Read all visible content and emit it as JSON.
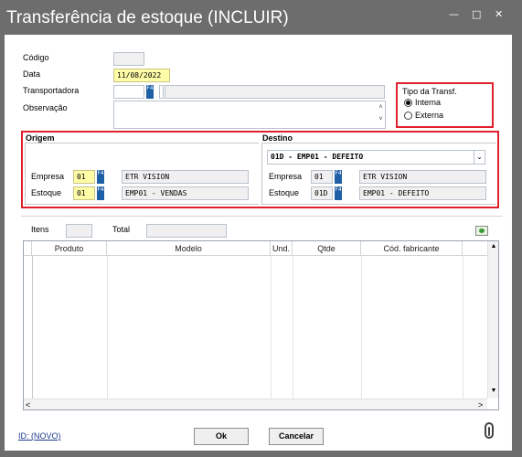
{
  "window": {
    "title": "Transferência de estoque (INCLUIR)",
    "minimize": "—",
    "maximize": "□",
    "close": "✕"
  },
  "header": {
    "codigo_label": "Código",
    "codigo_value": "",
    "data_label": "Data",
    "data_value": "11/08/2022",
    "transportadora_label": "Transportadora",
    "transportadora_code": "",
    "transportadora_name": "",
    "observacao_label": "Observação",
    "observacao_value": ""
  },
  "tipo": {
    "title": "Tipo da Transf.",
    "options": [
      "Interna",
      "Externa"
    ],
    "selected": "Interna"
  },
  "origem": {
    "title": "Origem",
    "empresa_label": "Empresa",
    "empresa_code": "01",
    "empresa_name": "ETR VISION",
    "estoque_label": "Estoque",
    "estoque_code": "01",
    "estoque_name": "EMP01 - VENDAS"
  },
  "destino": {
    "title": "Destino",
    "select_value": "01D - EMP01 - DEFEITO",
    "empresa_label": "Empresa",
    "empresa_code": "01",
    "empresa_name": "ETR VISION",
    "estoque_label": "Estoque",
    "estoque_code": "01D",
    "estoque_name": "EMP01 - DEFEITO"
  },
  "itens": {
    "itens_label": "Itens",
    "itens_value": "",
    "total_label": "Total",
    "total_value": "",
    "columns": [
      "Produto",
      "Modelo",
      "Und.",
      "Qtde",
      "Cód. fabricante"
    ]
  },
  "footer": {
    "id_label": "ID: (NOVO)",
    "ok_label": "Ok",
    "cancel_label": "Cancelar"
  },
  "f4_label": "F4",
  "colors": {
    "titlebar": "#6d6d6d",
    "highlight": "#e0202c",
    "required": "#fffca8",
    "f4": "#1f5fa5"
  }
}
